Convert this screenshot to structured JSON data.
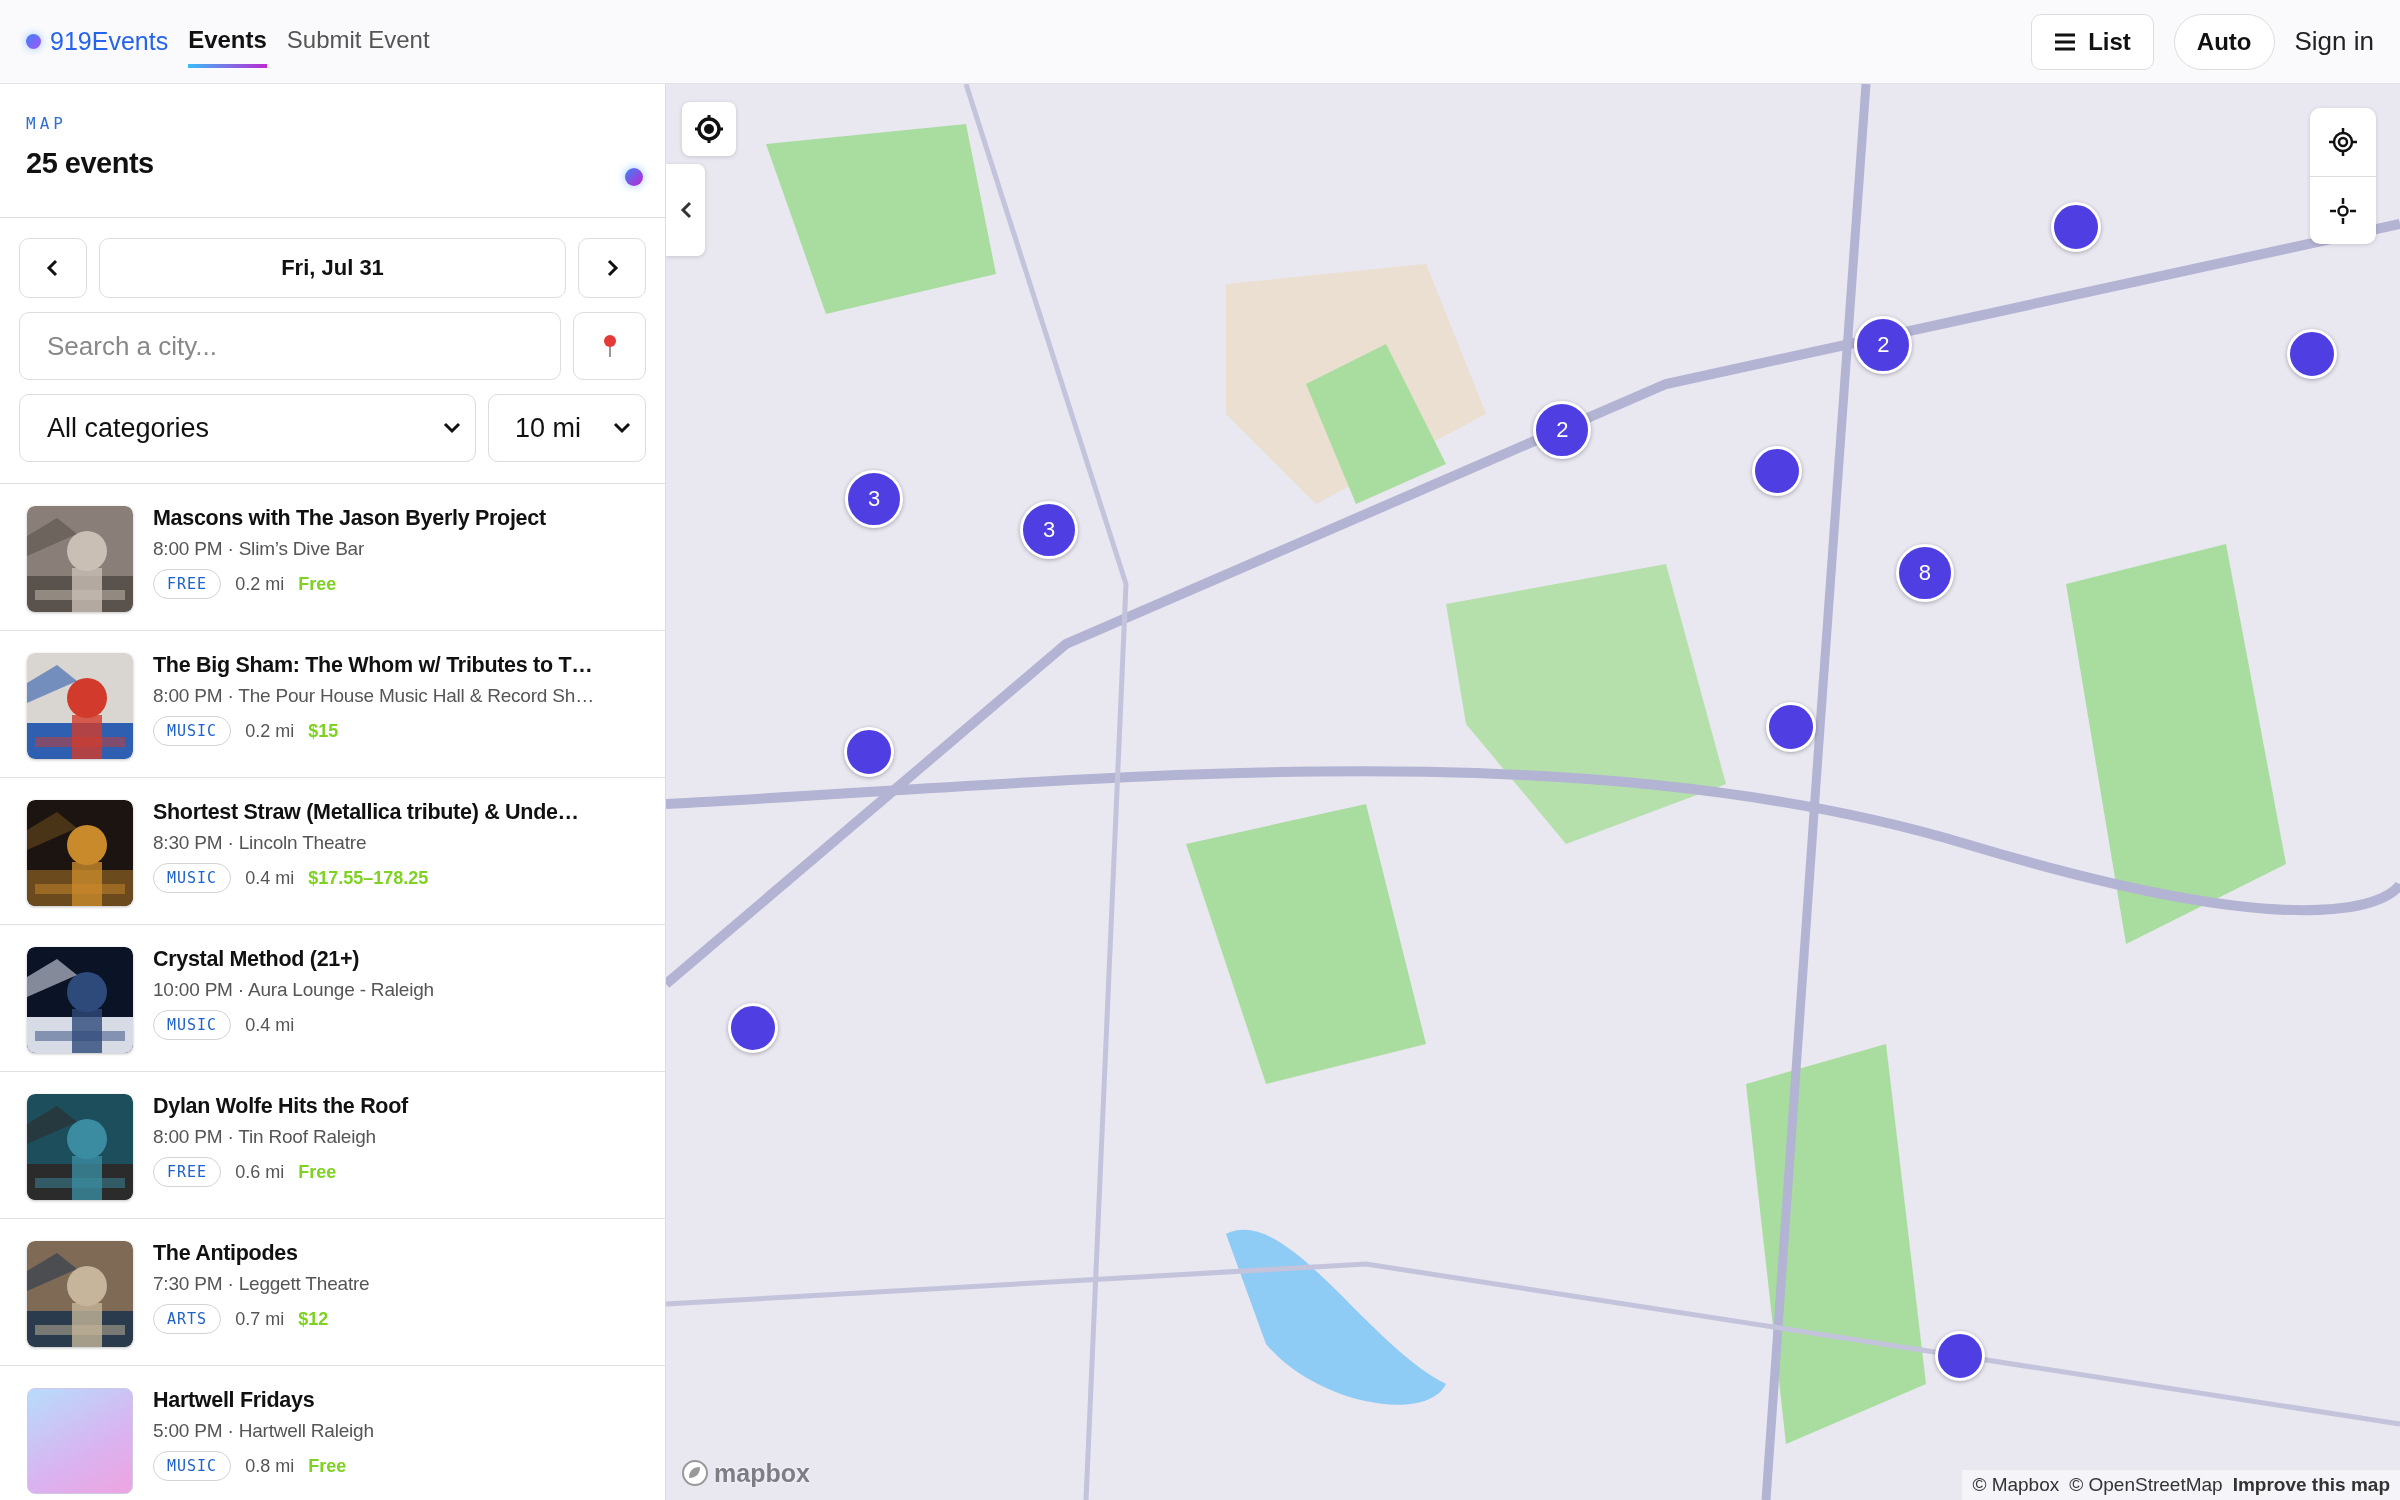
{
  "header": {
    "brand": "919Events",
    "nav": [
      {
        "label": "Events",
        "selected": true
      },
      {
        "label": "Submit Event",
        "selected": false
      }
    ],
    "list_button": "List",
    "theme_button": "Auto",
    "sign_in": "Sign in"
  },
  "sidebar": {
    "section_label": "MAP",
    "count": "25 events",
    "date": "Fri, Jul 31",
    "search": {
      "placeholder": "Search a city..."
    },
    "category": "All categories",
    "radius": "10 mi",
    "events": [
      {
        "title": "Mascons with The Jason Byerly Project",
        "meta": "8:00 PM · Slim’s Dive Bar",
        "tag": "FREE",
        "distance": "0.2 mi",
        "price": "Free"
      },
      {
        "title": "The Big Sham: The Whom w/ Tributes to T…",
        "meta": "8:00 PM · The Pour House Music Hall & Record Sh…",
        "tag": "MUSIC",
        "distance": "0.2 mi",
        "price": "$15"
      },
      {
        "title": "Shortest Straw (Metallica tribute) & Unde…",
        "meta": "8:30 PM · Lincoln Theatre",
        "tag": "MUSIC",
        "distance": "0.4 mi",
        "price": "$17.55–178.25"
      },
      {
        "title": "Crystal Method (21+)",
        "meta": "10:00 PM · Aura Lounge - Raleigh",
        "tag": "MUSIC",
        "distance": "0.4 mi"
      },
      {
        "title": "Dylan Wolfe Hits the Roof",
        "meta": "8:00 PM · Tin Roof Raleigh",
        "tag": "FREE",
        "distance": "0.6 mi",
        "price": "Free"
      },
      {
        "title": "The Antipodes",
        "meta": "7:30 PM · Leggett Theatre",
        "tag": "ARTS",
        "distance": "0.7 mi",
        "price": "$12"
      },
      {
        "thumbnail": {
          "kind": "placeholder"
        },
        "title": "Hartwell Fridays",
        "meta": "5:00 PM · Hartwell Raleigh",
        "tag": "MUSIC",
        "distance": "0.8 mi",
        "price": "Free"
      }
    ]
  },
  "map": {
    "kind": "picture",
    "markers": [
      {
        "kind": "single"
      },
      {
        "kind": "cluster",
        "count": "2"
      },
      {
        "kind": "single"
      },
      {
        "kind": "cluster",
        "count": "2"
      },
      {
        "kind": "single"
      },
      {
        "kind": "cluster",
        "count": "3"
      },
      {
        "kind": "cluster",
        "count": "3"
      },
      {
        "kind": "cluster",
        "count": "8"
      },
      {
        "kind": "single"
      },
      {
        "kind": "single"
      },
      {
        "kind": "single"
      },
      {
        "kind": "single"
      }
    ],
    "logo": "mapbox",
    "attribution": [
      "© Mapbox",
      "© OpenStreetMap"
    ],
    "improve_link": "Improve this map"
  }
}
